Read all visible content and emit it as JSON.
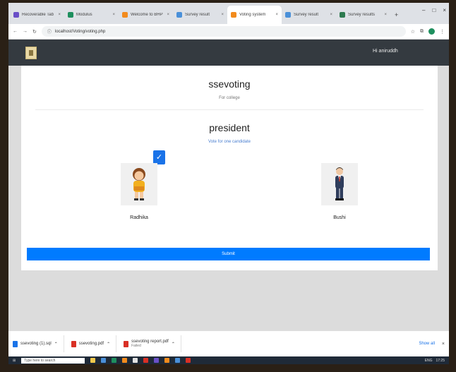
{
  "browser": {
    "tabs": [
      {
        "label": "Recoverable Tab",
        "color": "#6a4fc7",
        "active": false
      },
      {
        "label": "Modulus",
        "color": "#1e8f5e",
        "active": false
      },
      {
        "label": "Welcome to BHP",
        "color": "#f28b1d",
        "active": false
      },
      {
        "label": "Survey result",
        "color": "#4a90d9",
        "active": false
      },
      {
        "label": "Voting system",
        "color": "#f28b1d",
        "active": true
      },
      {
        "label": "Survey result",
        "color": "#4a90d9",
        "active": false
      },
      {
        "label": "Survey results",
        "color": "#2d7a4f",
        "active": false
      }
    ],
    "url": "localhost/Voting/voting.php",
    "window_controls": [
      "–",
      "□",
      "×"
    ]
  },
  "navbar": {
    "logo_icon": "school-logo-icon",
    "user_label": "Hi aniruddh"
  },
  "ballot": {
    "election_title": "ssevoting",
    "election_subtitle": "For college",
    "position_title": "president",
    "position_subtitle": "Vote for one candidate",
    "candidates": [
      {
        "name": "Radhika",
        "selected": true,
        "avatar": "female-student-avatar"
      },
      {
        "name": "Bushi",
        "selected": false,
        "avatar": "male-suit-avatar"
      }
    ],
    "submit_label": "Submit"
  },
  "downloads": {
    "items": [
      {
        "label": "ssevoting (1).sql",
        "sub": "",
        "color": "#1a73e8"
      },
      {
        "label": "ssevoting.pdf",
        "sub": "",
        "color": "#d93025"
      },
      {
        "label": "ssevoting report.pdf",
        "sub": "Failed",
        "color": "#d93025"
      }
    ],
    "show_all": "Show all",
    "close": "×"
  },
  "taskbar": {
    "search_placeholder": "Type here to search",
    "icons": [
      "#f2c94c",
      "#4a90d9",
      "#1e8f5e",
      "#f28b1d",
      "#e2e2e2",
      "#d93025",
      "#6a4fc7",
      "#f28b1d",
      "#4a90d9",
      "#d93025"
    ],
    "tray": [
      "ENG",
      "17:25"
    ]
  }
}
